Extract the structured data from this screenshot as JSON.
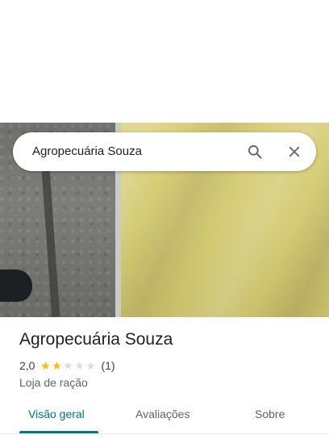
{
  "search": {
    "query": "Agropecuária Souza"
  },
  "place": {
    "name": "Agropecuária Souza",
    "rating": "2,0",
    "rating_stars": 2,
    "rating_max": 5,
    "review_count": "(1)",
    "category": "Loja de ração"
  },
  "tabs": [
    {
      "label": "Visão geral",
      "active": true
    },
    {
      "label": "Avaliações",
      "active": false
    },
    {
      "label": "Sobre",
      "active": false
    }
  ],
  "colors": {
    "accent": "#01787a",
    "star": "#fbbc04",
    "star_empty": "#dadce0"
  },
  "icons": {
    "search": "search-icon",
    "close": "close-icon",
    "star": "star-icon"
  }
}
